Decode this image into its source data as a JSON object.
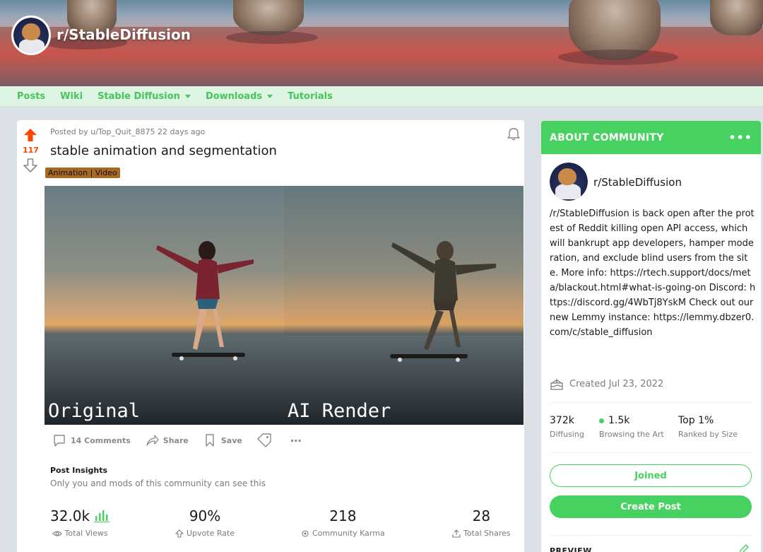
{
  "header": {
    "subreddit_name": "r/StableDiffusion"
  },
  "nav": {
    "items": [
      {
        "label": "Posts",
        "dropdown": false
      },
      {
        "label": "Wiki",
        "dropdown": false
      },
      {
        "label": "Stable Diffusion",
        "dropdown": true
      },
      {
        "label": "Downloads",
        "dropdown": true
      },
      {
        "label": "Tutorials",
        "dropdown": false
      }
    ]
  },
  "post": {
    "vote_count": "117",
    "meta": "Posted by u/Top_Quit_8875 22 days ago",
    "title": "stable animation and segmentation",
    "flair": "Animation | Video",
    "media": {
      "left_label": "Original",
      "right_label": "AI Render"
    },
    "actions": {
      "comments": "14 Comments",
      "share": "Share",
      "save": "Save"
    },
    "insights": {
      "title": "Post Insights",
      "subtitle": "Only you and mods of this community can see this",
      "stats": [
        {
          "value": "32.0k",
          "label": "Total Views"
        },
        {
          "value": "90%",
          "label": "Upvote Rate"
        },
        {
          "value": "218",
          "label": "Community Karma"
        },
        {
          "value": "28",
          "label": "Total Shares"
        }
      ]
    }
  },
  "sidebar": {
    "header": "ABOUT COMMUNITY",
    "name": "r/StableDiffusion",
    "description": "/r/StableDiffusion is back open after the protest of Reddit killing open API access, which will bankrupt app developers, hamper moderation, and exclude blind users from the site. More info: https://rtech.support/docs/meta/blackout.html#what-is-going-on Discord: https://discord.gg/4WbTj8YskM Check out our new Lemmy instance: https://lemmy.dbzer0.com/c/stable_diffusion",
    "created": "Created Jul 23, 2022",
    "stats": [
      {
        "value": "372k",
        "label": "Diffusing"
      },
      {
        "value": "1.5k",
        "label": "Browsing the Art"
      },
      {
        "value": "Top 1%",
        "label": "Ranked by Size"
      }
    ],
    "joined_label": "Joined",
    "create_post_label": "Create Post",
    "preview_label": "PREVIEW"
  },
  "colors": {
    "accent": "#46d160",
    "nav_text": "#46c45e",
    "upvote": "#ff4500",
    "flair_bg": "#a86a22"
  }
}
